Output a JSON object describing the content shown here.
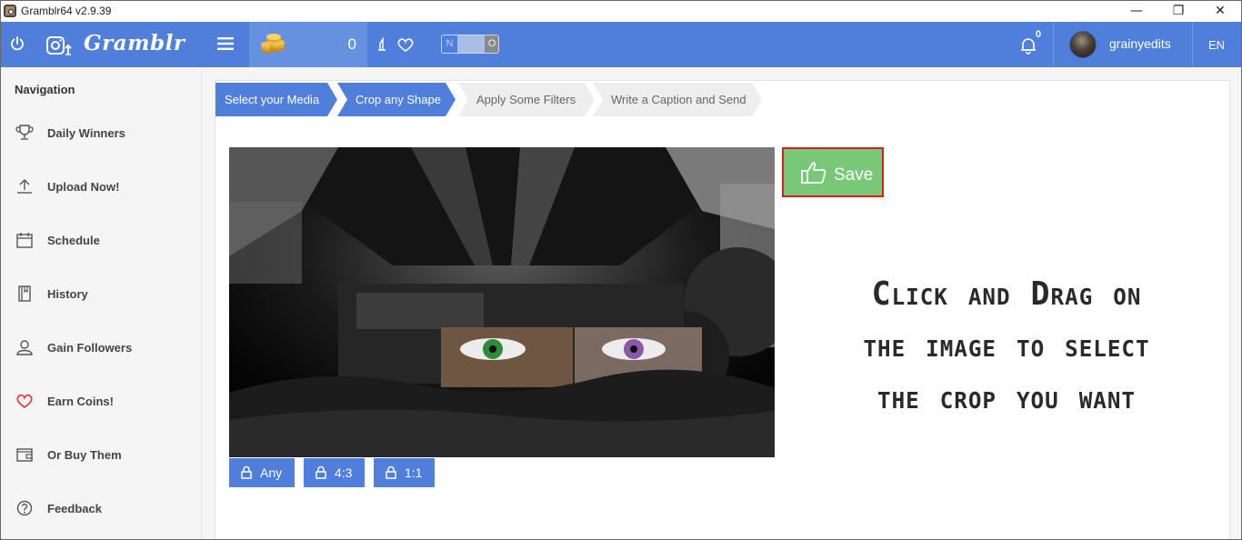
{
  "window": {
    "title": "Gramblr64 v2.9.39",
    "controls": {
      "minimize": "—",
      "maximize": "❐",
      "close": "✕"
    }
  },
  "header": {
    "brand": "Gramblr",
    "coins": "0",
    "toggle": {
      "left": "N",
      "right": "O"
    },
    "notifications": "0",
    "username": "grainyedits",
    "language": "EN",
    "accent_color": "#4f7fdb"
  },
  "sidebar": {
    "title": "Navigation",
    "items": [
      {
        "label": "Daily Winners",
        "icon": "trophy-icon"
      },
      {
        "label": "Upload Now!",
        "icon": "upload-icon"
      },
      {
        "label": "Schedule",
        "icon": "calendar-icon"
      },
      {
        "label": "History",
        "icon": "book-icon"
      },
      {
        "label": "Gain Followers",
        "icon": "user-icon"
      },
      {
        "label": "Earn Coins!",
        "icon": "heart-icon"
      },
      {
        "label": "Or Buy Them",
        "icon": "wallet-icon"
      },
      {
        "label": "Feedback",
        "icon": "question-icon"
      }
    ]
  },
  "steps": [
    {
      "label": "Select your Media",
      "state": "active"
    },
    {
      "label": "Crop any Shape",
      "state": "active"
    },
    {
      "label": "Apply Some Filters",
      "state": "inactive"
    },
    {
      "label": "Write a Caption and Send",
      "state": "inactive"
    }
  ],
  "editor": {
    "save_label": "Save",
    "instruction_lines": [
      "Click and Drag on",
      "the image to select",
      "the crop you want"
    ],
    "crop_options": [
      "Any",
      "4:3",
      "1:1"
    ]
  }
}
